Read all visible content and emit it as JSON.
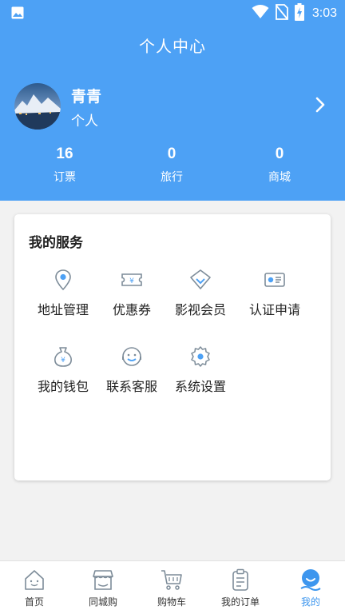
{
  "status_bar": {
    "time": "3:03"
  },
  "header": {
    "title": "个人中心"
  },
  "profile": {
    "name": "青青",
    "nickname": "个人"
  },
  "stats": [
    {
      "value": "16",
      "label": "订票"
    },
    {
      "value": "0",
      "label": "旅行"
    },
    {
      "value": "0",
      "label": "商城"
    }
  ],
  "services": {
    "title": "我的服务",
    "items": [
      {
        "label": "地址管理",
        "icon": "location-pin-icon"
      },
      {
        "label": "优惠券",
        "icon": "coupon-icon"
      },
      {
        "label": "影视会员",
        "icon": "vip-diamond-icon"
      },
      {
        "label": "认证申请",
        "icon": "id-card-icon"
      },
      {
        "label": "我的钱包",
        "icon": "money-bag-icon"
      },
      {
        "label": "联系客服",
        "icon": "customer-service-icon"
      },
      {
        "label": "系统设置",
        "icon": "gear-icon"
      }
    ]
  },
  "tabbar": {
    "items": [
      {
        "label": "首页",
        "icon": "home-icon"
      },
      {
        "label": "同城购",
        "icon": "store-icon"
      },
      {
        "label": "购物车",
        "icon": "cart-icon"
      },
      {
        "label": "我的订单",
        "icon": "clipboard-icon"
      },
      {
        "label": "我的",
        "icon": "smile-icon",
        "active": true
      }
    ]
  },
  "colors": {
    "header": "#4da1f5",
    "accent": "#3d96ee",
    "icon_stroke": "#7d8c99"
  }
}
